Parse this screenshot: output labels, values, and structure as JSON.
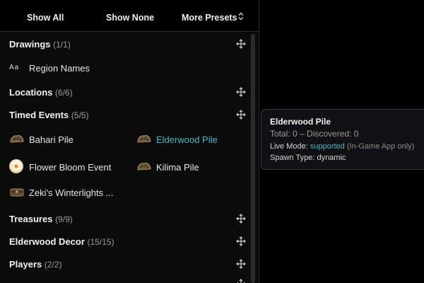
{
  "toolbar": {
    "show_all": "Show All",
    "show_none": "Show None",
    "more_presets": "More Presets",
    "chevron": "⌃⌄"
  },
  "sidebar": {
    "groups": [
      {
        "label": "Drawings",
        "count": "(1/1)"
      },
      {
        "label": "Locations",
        "count": "(6/6)"
      },
      {
        "label": "Timed Events",
        "count": "(5/5)"
      },
      {
        "label": "Treasures",
        "count": "(9/9)"
      },
      {
        "label": "Elderwood Decor",
        "count": "(15/15)"
      },
      {
        "label": "Players",
        "count": "(2/2)"
      }
    ],
    "region_names": {
      "glyph": "Aa",
      "label": "Region Names"
    },
    "timed_items": [
      {
        "label": "Bahari Pile",
        "icon": "pile-icon"
      },
      {
        "label": "Elderwood Pile",
        "icon": "pile-icon",
        "active": true
      },
      {
        "label": "Flower Bloom Event",
        "icon": "flower-icon"
      },
      {
        "label": "Kilima Pile",
        "icon": "pile-icon"
      },
      {
        "label": "Zeki's Winterlights ...",
        "icon": "chest-icon"
      }
    ]
  },
  "tooltip": {
    "title": "Elderwood Pile",
    "total": "Total: 0 – Discovered: 0",
    "live_mode_label": "Live Mode:",
    "live_mode_value": "supported",
    "live_mode_note": "(In-Game App only)",
    "spawn_type": "Spawn Type: dynamic"
  },
  "colors": {
    "accent": "#45b8c2",
    "background": "#000000",
    "panel": "#0b0b0c"
  }
}
